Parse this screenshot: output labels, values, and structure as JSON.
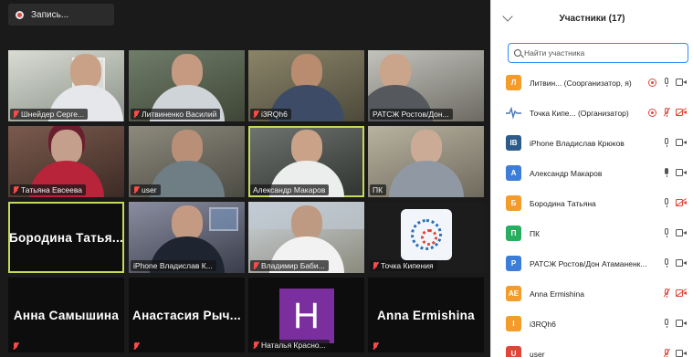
{
  "recording": {
    "label": "Запись..."
  },
  "gallery": {
    "tiles": [
      {
        "label": "Шнейдер Серге..."
      },
      {
        "label": "Литвиненко Василий"
      },
      {
        "label": "i3RQh6"
      },
      {
        "label": "РАТСЖ Ростов/Дон..."
      },
      {
        "label": "Татьяна Евсеева"
      },
      {
        "label": "user"
      },
      {
        "label": "Александр Макаров"
      },
      {
        "label": "ПК"
      },
      {
        "label": "Бородина  Татья..."
      },
      {
        "label": "iPhone Владислав К..."
      },
      {
        "label": "Владимир Баби..."
      },
      {
        "label": "Точка Кипения"
      },
      {
        "label": "Анна Самышина"
      },
      {
        "label": "Анастасия  Рыч..."
      },
      {
        "label": "Наталья Красно...",
        "avatar_letter": "H"
      },
      {
        "label": "Anna Ermishina"
      }
    ]
  },
  "panel": {
    "title": "Участники (17)",
    "search_placeholder": "Найти участника",
    "participants": [
      {
        "initial": "Л",
        "color": "#f39c2b",
        "name": "Литвин... (Соорганизатор, я)",
        "mic": "on",
        "cam": "on",
        "host": true
      },
      {
        "initial": "",
        "color": "#9aa7b3",
        "name": "Точка Кипе... (Организатор)",
        "mic": "muted",
        "cam": "off",
        "host": true
      },
      {
        "initial": "IB",
        "color": "#2e5c8a",
        "name": "iPhone Владислав Крюков",
        "mic": "on",
        "cam": "on",
        "host": false
      },
      {
        "initial": "A",
        "color": "#3b7dd8",
        "name": "Александр Макаров",
        "mic": "live",
        "cam": "on",
        "host": false
      },
      {
        "initial": "Б",
        "color": "#f39c2b",
        "name": "Бородина Татьяна",
        "mic": "on",
        "cam": "off",
        "host": false
      },
      {
        "initial": "П",
        "color": "#27ae60",
        "name": "ПК",
        "mic": "on",
        "cam": "on",
        "host": false
      },
      {
        "initial": "P",
        "color": "#3b7dd8",
        "name": "РАТСЖ Ростов/Дон Атаманенк...",
        "mic": "on",
        "cam": "on",
        "host": false
      },
      {
        "initial": "AE",
        "color": "#f39c2b",
        "name": "Anna Ermishina",
        "mic": "muted",
        "cam": "off",
        "host": false
      },
      {
        "initial": "I",
        "color": "#f39c2b",
        "name": "i3RQh6",
        "mic": "on",
        "cam": "on",
        "host": false
      },
      {
        "initial": "U",
        "color": "#e0453a",
        "name": "user",
        "mic": "muted",
        "cam": "on",
        "host": false
      }
    ]
  }
}
